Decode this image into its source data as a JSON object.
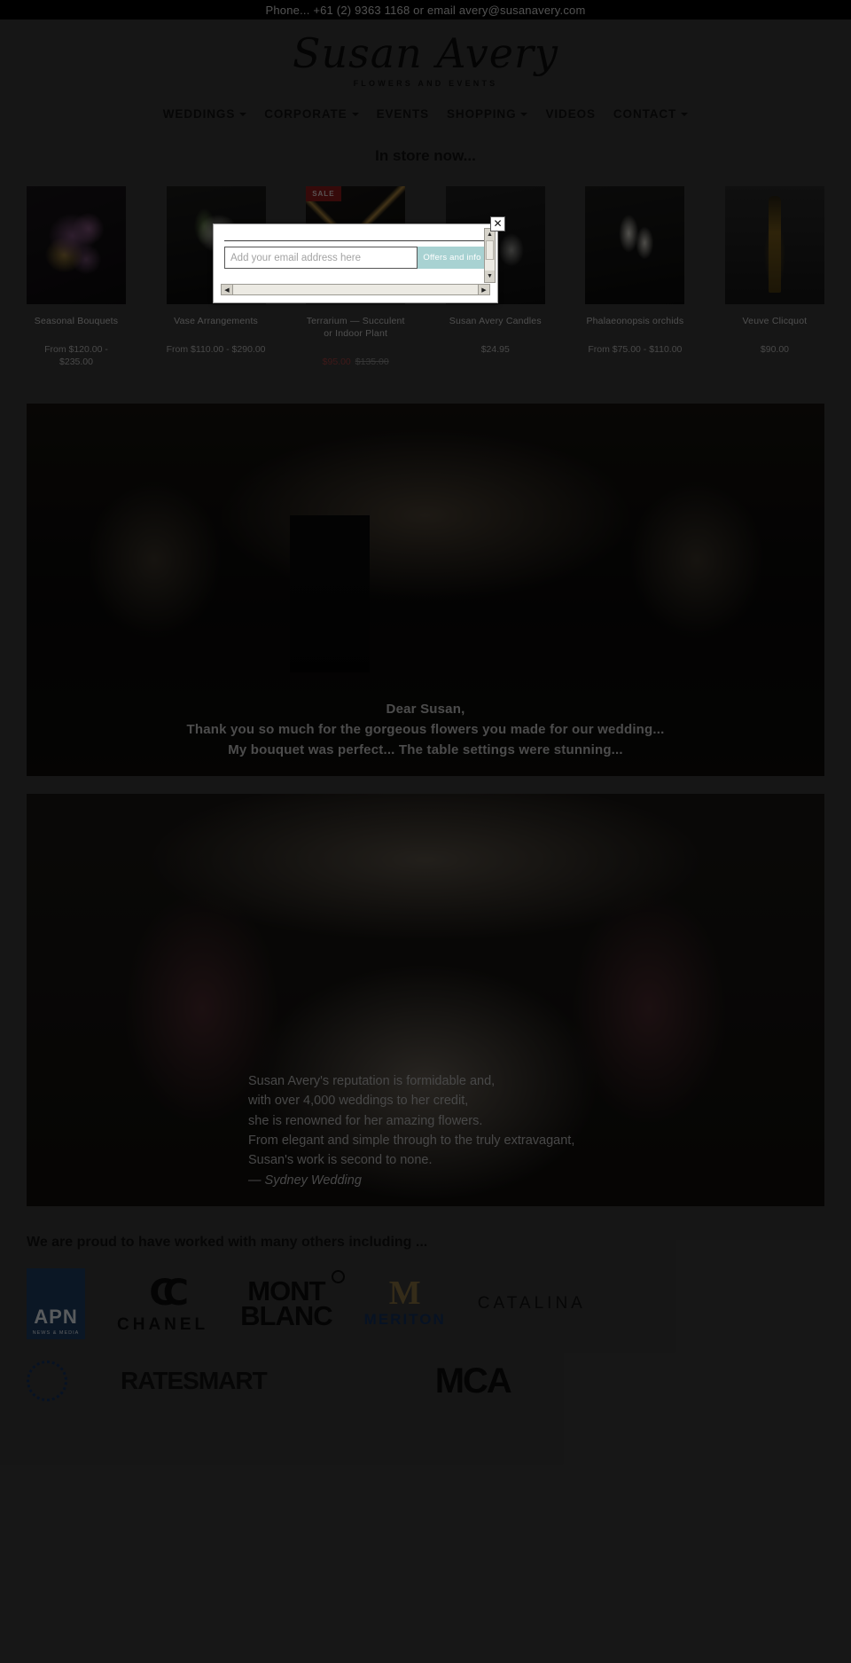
{
  "topbar": {
    "contact_text": "Phone... +61 (2) 9363 1168 or email avery@susanavery.com"
  },
  "header": {
    "logo_script": "Susan Avery",
    "logo_tagline": "FLOWERS AND EVENTS"
  },
  "nav": {
    "items": [
      {
        "label": "WEDDINGS",
        "has_dropdown": true
      },
      {
        "label": "CORPORATE",
        "has_dropdown": true
      },
      {
        "label": "EVENTS",
        "has_dropdown": false
      },
      {
        "label": "SHOPPING",
        "has_dropdown": true
      },
      {
        "label": "VIDEOS",
        "has_dropdown": false
      },
      {
        "label": "CONTACT",
        "has_dropdown": true
      }
    ]
  },
  "store": {
    "title": "In store now...",
    "products": [
      {
        "name": "Seasonal Bouquets",
        "price": "From $120.00 - $235.00",
        "sale_price": "",
        "old_price": "",
        "badge": "",
        "art": "img-bouquet"
      },
      {
        "name": "Vase Arrangements",
        "price": "From $110.00 - $290.00",
        "sale_price": "",
        "old_price": "",
        "badge": "",
        "art": "img-vase"
      },
      {
        "name": "Terrarium — Succulent or Indoor Plant",
        "price": "",
        "sale_price": "$95.00",
        "old_price": "$135.00",
        "badge": "SALE",
        "art": "img-terrarium"
      },
      {
        "name": "Susan Avery Candles",
        "price": "$24.95",
        "sale_price": "",
        "old_price": "",
        "badge": "",
        "art": "img-candles"
      },
      {
        "name": "Phalaeonopsis orchids",
        "price": "From $75.00 - $110.00",
        "sale_price": "",
        "old_price": "",
        "badge": "",
        "art": "img-orchids"
      },
      {
        "name": "Veuve Clicquot",
        "price": "$90.00",
        "sale_price": "",
        "old_price": "",
        "badge": "",
        "art": "img-veuve"
      }
    ]
  },
  "hero1": {
    "line1": "Dear Susan,",
    "line2": "Thank you so much for the gorgeous flowers you made for our wedding...",
    "line3": "My bouquet was perfect...    The table settings were stunning..."
  },
  "hero2": {
    "line1": "Susan Avery's reputation is formidable and,",
    "line2": "with over 4,000 weddings to her credit,",
    "line3": "she is renowned for her amazing flowers.",
    "line4": "From elegant and simple through to the truly extravagant,",
    "line5": "Susan's work is second to none.",
    "attribution": "— Sydney Wedding"
  },
  "partners": {
    "title": "We are proud to have worked with many others including ...",
    "logos": [
      {
        "name": "APN News & Media",
        "main": "APN",
        "sub": "NEWS & MEDIA"
      },
      {
        "name": "Chanel",
        "main": "CHANEL",
        "sub": ""
      },
      {
        "name": "Mont Blanc",
        "main": "MONT",
        "sub": "BLANC"
      },
      {
        "name": "Meriton",
        "main": "M",
        "sub": "MERITON"
      },
      {
        "name": "Catalina",
        "main": "CATALINA",
        "sub": ""
      },
      {
        "name": "MCA",
        "main": "MCA",
        "sub": ""
      },
      {
        "name": "RateSmart",
        "main": "RATESMART",
        "sub": ""
      }
    ]
  },
  "modal": {
    "close_label": "✕",
    "email_placeholder": "Add your email address here",
    "email_value": "",
    "submit_label": "Offers and info",
    "scroll_left_arrow": "◀",
    "scroll_right_arrow": "▶",
    "scroll_up_arrow": "▲",
    "scroll_down_arrow": "▼"
  },
  "colors": {
    "page_bg": "#3c3c3c",
    "topbar_bg": "#000000",
    "accent_button": "#a8d2d2",
    "sale_badge": "#8e1b1b",
    "sale_price": "#a24040"
  }
}
